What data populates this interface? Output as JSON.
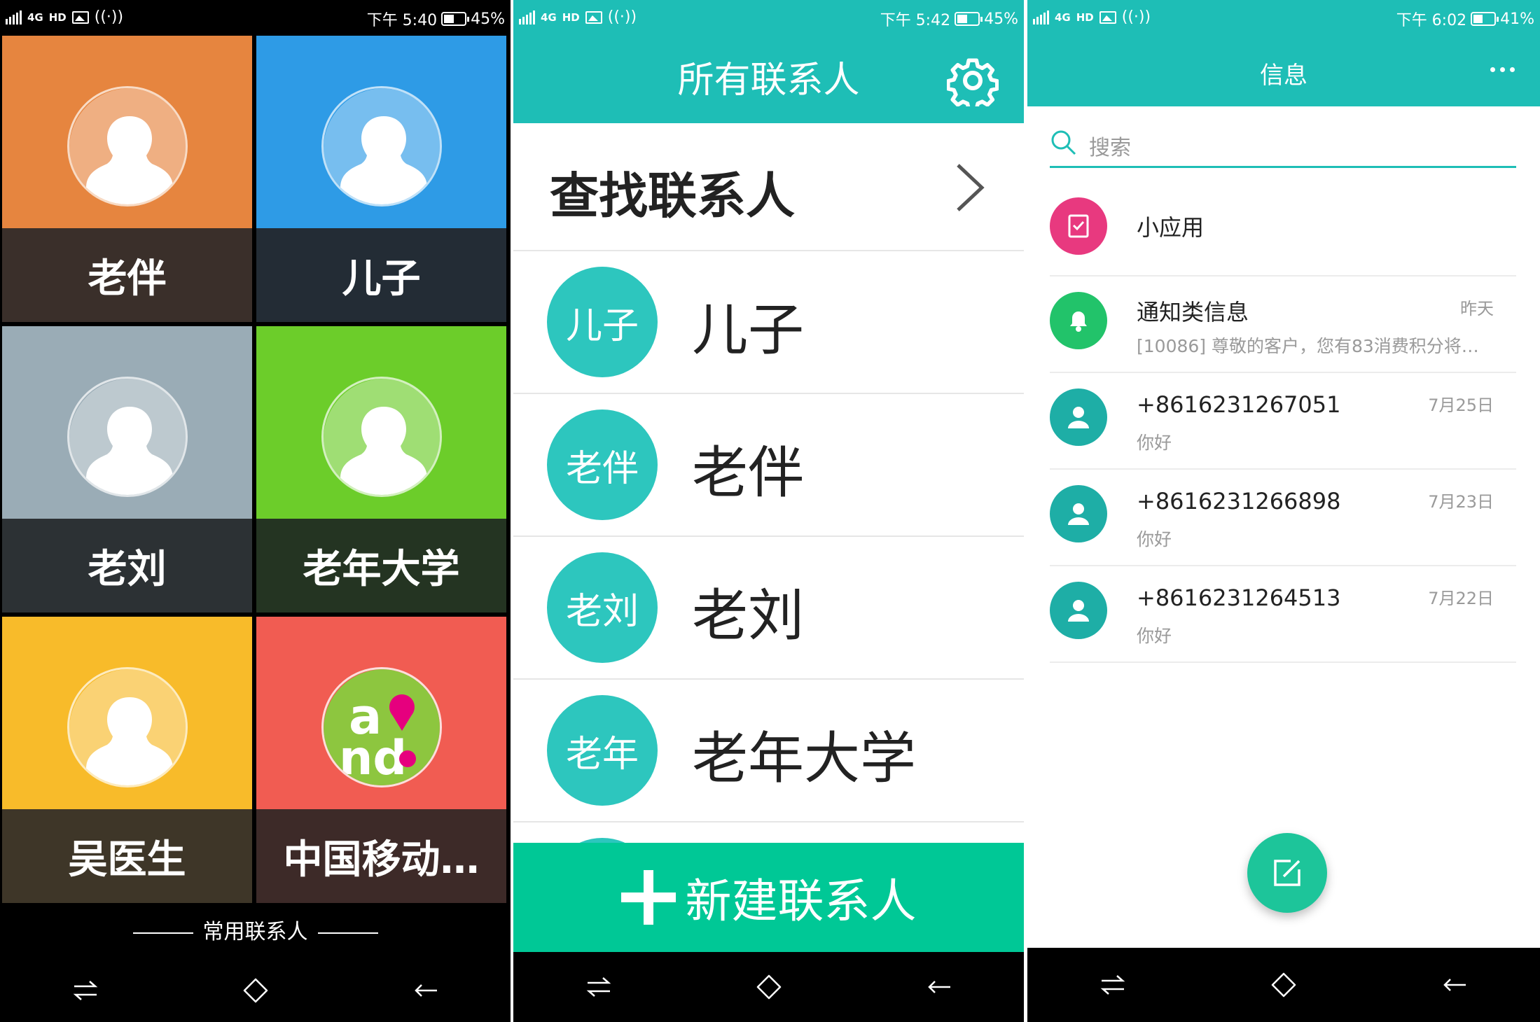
{
  "phone1": {
    "status": {
      "time": "下午 5:40",
      "battery": "45%",
      "net": "4G",
      "hd": "HD"
    },
    "tiles": [
      {
        "name": "老伴",
        "top_color": "#e6853f",
        "bottom_color": "#3a2f2a"
      },
      {
        "name": "儿子",
        "top_color": "#2e9be6",
        "bottom_color": "#232c35"
      },
      {
        "name": "老刘",
        "top_color": "#9aacb6",
        "bottom_color": "#2c3134"
      },
      {
        "name": "老年大学",
        "top_color": "#6ccd2a",
        "bottom_color": "#243422"
      },
      {
        "name": "吴医生",
        "top_color": "#f8bb2a",
        "bottom_color": "#3e3628"
      },
      {
        "name": "中国移动…",
        "top_color": "#f15c52",
        "bottom_color": "#3d2a28"
      }
    ],
    "caption": "常用联系人"
  },
  "phone2": {
    "status": {
      "time": "下午 5:42",
      "battery": "45%",
      "net": "4G",
      "hd": "HD"
    },
    "title": "所有联系人",
    "find_label": "查找联系人",
    "contacts": [
      {
        "badge": "儿子",
        "name": "儿子"
      },
      {
        "badge": "老伴",
        "name": "老伴"
      },
      {
        "badge": "老刘",
        "name": "老刘"
      },
      {
        "badge": "老年",
        "name": "老年大学"
      }
    ],
    "new_button": "新建联系人"
  },
  "phone3": {
    "status": {
      "time": "下午 6:02",
      "battery": "41%",
      "net": "4G",
      "hd": "HD"
    },
    "title": "信息",
    "search_placeholder": "搜索",
    "rows": [
      {
        "title": "小应用",
        "sub": "",
        "date": "",
        "icon": "app-icon",
        "color": "#e8397f"
      },
      {
        "title": "通知类信息",
        "sub": "[10086] 尊敬的客户，您有83消费积分将…",
        "date": "昨天",
        "icon": "bell-icon",
        "color": "#22c36a"
      },
      {
        "title": "+8616231267051",
        "sub": "你好",
        "date": "7月25日",
        "icon": "person-icon",
        "color": "#1eaea6"
      },
      {
        "title": "+8616231266898",
        "sub": "你好",
        "date": "7月23日",
        "icon": "person-icon",
        "color": "#1eaea6"
      },
      {
        "title": "+8616231264513",
        "sub": "你好",
        "date": "7月22日",
        "icon": "person-icon",
        "color": "#1eaea6"
      }
    ]
  }
}
